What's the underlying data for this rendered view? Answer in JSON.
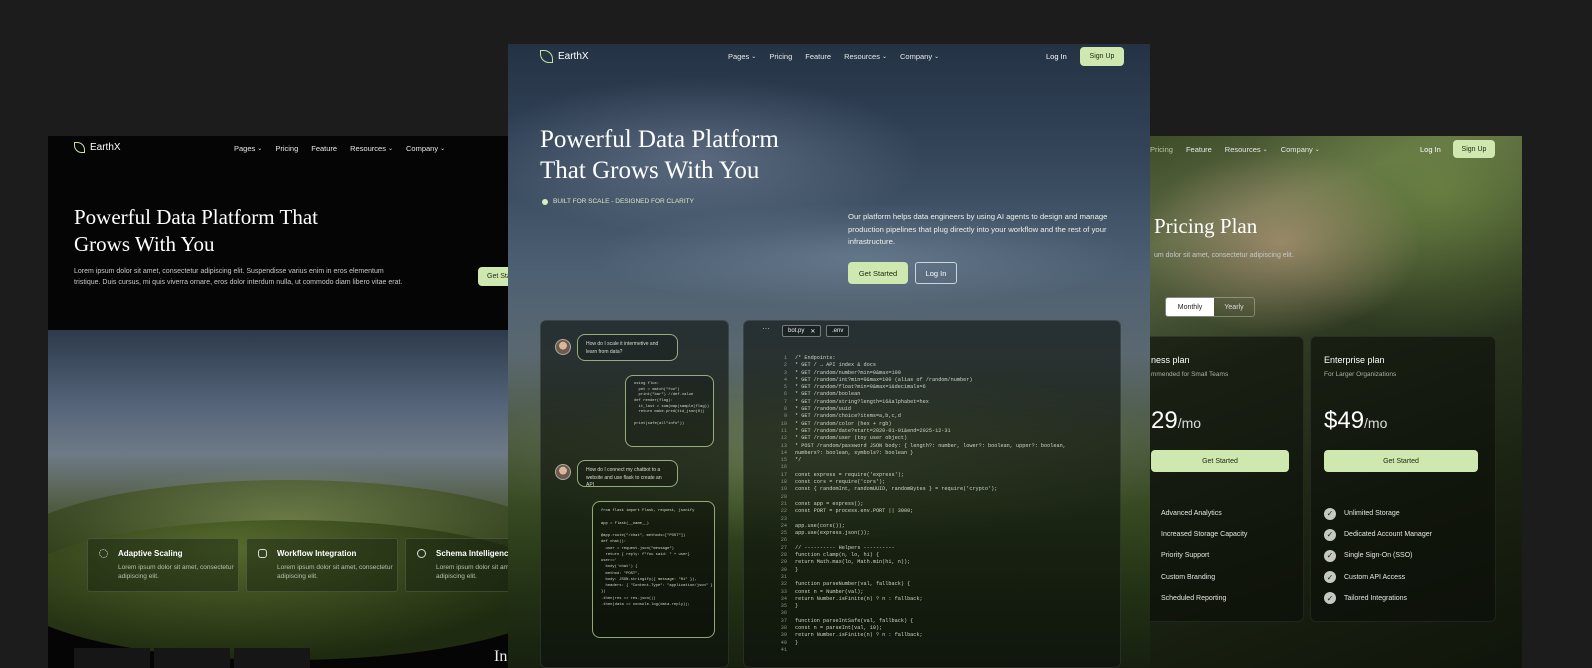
{
  "brand": "EarthX",
  "nav": {
    "pages": "Pages",
    "pricing": "Pricing",
    "feature": "Feature",
    "resources": "Resources",
    "company": "Company",
    "login": "Log In",
    "signup": "Sign Up"
  },
  "left": {
    "title_line1": "Powerful Data Platform That",
    "title_line2": "Grows With You",
    "desc_line1": "Lorem ipsum dolor sit amet, consectetur adipiscing elit. Suspendisse varius enim in eros elementum",
    "desc_line2": "tristique. Duis cursus, mi quis viverra ornare, eros dolor interdum nulla, ut commodo diam libero vitae erat.",
    "cta": "Get Start",
    "features": [
      {
        "title": "Adaptive Scaling",
        "desc": "Lorem ipsum dolor sit amet, consectetur adipiscing elit."
      },
      {
        "title": "Workflow Integration",
        "desc": "Lorem ipsum dolor sit amet, consectetur adipiscing elit."
      },
      {
        "title": "Schema Intelligence",
        "desc": "Lorem ipsum dolor sit amet, consectetur adipiscing elit."
      }
    ],
    "bottom_fragment": "In"
  },
  "center": {
    "title_line1": "Powerful Data Platform",
    "title_line2": "That Grows With You",
    "badge": "BUILT FOR SCALE - DESIGNED FOR CLARITY",
    "desc": "Our platform helps data engineers by using AI agents to design and manage production pipelines that plug directly into your workflow and the rest of your infrastructure.",
    "get_started": "Get Started",
    "login": "Log In",
    "chat": {
      "q1": "How do I scale it intermetive and learn from data?",
      "a1": "using flux:\n  pet = match(\"foo\")\n  print(\"bar\") //def.value\ndef render(flag):\n  it_last = sum(map(sample(flag))\n  return make.pred(tid_json(0))\n\nprint(safe(all\"info\"))",
      "q2": "How do I connect my chatbot to a website and use flask to create an API",
      "a2": "from flask import Flask, request, jsonify\n\napp = Flask(__name__)\n\n@app.route(\"/chat\", methods=[\"POST\"])\ndef chat():\n  user = request.json(\"message\")\n  return { reply: f\"You said: \" + user}\nuser=='\n  body('chat') {\n  method: \"POST\",\n  body: JSON.stringify({ message: \"Hi\" }),\n  headers: { \"Content-Type\": \"application/json\" }\n})\n.then(res => res.json())\n.then(data => console.log(data.reply));"
    },
    "code_tabs": [
      "bot.py",
      ".env"
    ],
    "code_lines": [
      "/* Endpoints:",
      " *  GET  /              → API index & docs",
      " *  GET  /random/number?min=0&max=100",
      " *  GET  /random/int?min=0&max=100        (alias of /random/number)",
      " *  GET  /random/float?min=0&max=1&decimals=6",
      " *  GET  /random/boolean",
      " *  GET  /random/string?length=16&alphabet=hex",
      " *  GET  /random/uuid",
      " *  GET  /random/choice?items=a,b,c,d",
      " *  GET  /random/color              (hex + rgb)",
      " *  GET  /random/date?start=2020-01-01&end=2025-12-31",
      " *  GET  /random/user               (toy user object)",
      " *  POST /random/password   JSON body: { length?: number, lower?: boolean, upper?: boolean,",
      "numbers?: boolean, symbols?: boolean }",
      " */",
      "",
      "const express = require('express');",
      "const cors = require('cors');",
      "const { randomInt, randomUUID, randomBytes } = require('crypto');",
      "",
      "const app = express();",
      "const PORT = process.env.PORT || 3000;",
      "",
      "app.use(cors());",
      "app.use(express.json());",
      "",
      "// ---------- Helpers ----------",
      "function clamp(n, lo, hi) {",
      "  return Math.max(lo, Math.min(hi, n));",
      "}",
      "",
      "function parseNumber(val, fallback) {",
      "  const n = Number(val);",
      "  return Number.isFinite(n) ? n : fallback;",
      "}",
      "",
      "function parseIntSafe(val, fallback) {",
      "  const n = parseInt(val, 10);",
      "  return Number.isFinite(n) ? n : fallback;",
      "}",
      ""
    ]
  },
  "right": {
    "nav_pricing": "Pricing",
    "title": "Pricing Plan",
    "subtitle": "um dolor sit amet, consectetur adipiscing elit.",
    "toggle_monthly": "Monthly",
    "toggle_yearly": "Yearly",
    "plans": [
      {
        "name": "ness plan",
        "sub": "mmended for Small Teams",
        "price": "29",
        "per": "/mo",
        "cta": "Get Started",
        "features": [
          "Advanced Analytics",
          "Increased Storage Capacity",
          "Priority Support",
          "Custom Branding",
          "Scheduled Reporting"
        ]
      },
      {
        "name": "Enterprise plan",
        "sub": "For Larger Organizations",
        "price": "$49",
        "per": "/mo",
        "cta": "Get Started",
        "features": [
          "Unlimited Storage",
          "Dedicated Account Manager",
          "Single Sign-On (SSO)",
          "Custom API Access",
          "Tailored Integrations"
        ]
      }
    ]
  },
  "colors": {
    "accent_green": "#cfe8b0",
    "background": "#1c1c1c"
  }
}
